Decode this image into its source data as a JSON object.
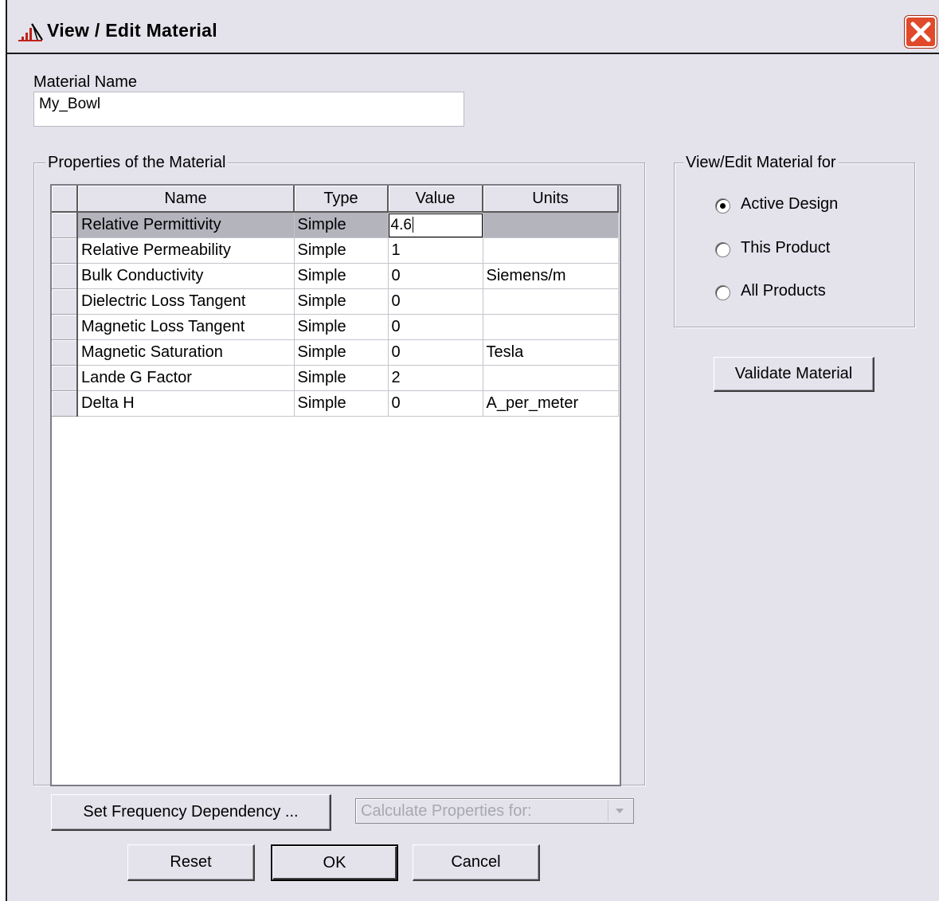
{
  "window": {
    "title": "View / Edit Material"
  },
  "material_name": {
    "label": "Material Name",
    "value": "My_Bowl"
  },
  "properties": {
    "group_label": "Properties of the Material",
    "columns": [
      "Name",
      "Type",
      "Value",
      "Units"
    ],
    "rows": [
      {
        "name": "Relative Permittivity",
        "type": "Simple",
        "value": "4.6",
        "units": ""
      },
      {
        "name": "Relative Permeability",
        "type": "Simple",
        "value": "1",
        "units": ""
      },
      {
        "name": "Bulk Conductivity",
        "type": "Simple",
        "value": "0",
        "units": "Siemens/m"
      },
      {
        "name": "Dielectric Loss Tangent",
        "type": "Simple",
        "value": "0",
        "units": ""
      },
      {
        "name": "Magnetic Loss Tangent",
        "type": "Simple",
        "value": "0",
        "units": ""
      },
      {
        "name": "Magnetic Saturation",
        "type": "Simple",
        "value": "0",
        "units": "Tesla"
      },
      {
        "name": "Lande G Factor",
        "type": "Simple",
        "value": "2",
        "units": ""
      },
      {
        "name": "Delta H",
        "type": "Simple",
        "value": "0",
        "units": "A_per_meter"
      }
    ]
  },
  "view_edit_for": {
    "group_label": "View/Edit Material for",
    "options": [
      "Active Design",
      "This Product",
      "All Products"
    ],
    "selected": "Active Design"
  },
  "buttons": {
    "validate": "Validate Material",
    "set_frequency": "Set Frequency Dependency ...",
    "reset": "Reset",
    "ok": "OK",
    "cancel": "Cancel"
  },
  "calculate_combo": {
    "placeholder": "Calculate Properties for:"
  },
  "colors": {
    "dialog_bg": "#e4e3ec",
    "close_button": "#e04a2a",
    "selected_row": "#b4b4bd"
  }
}
